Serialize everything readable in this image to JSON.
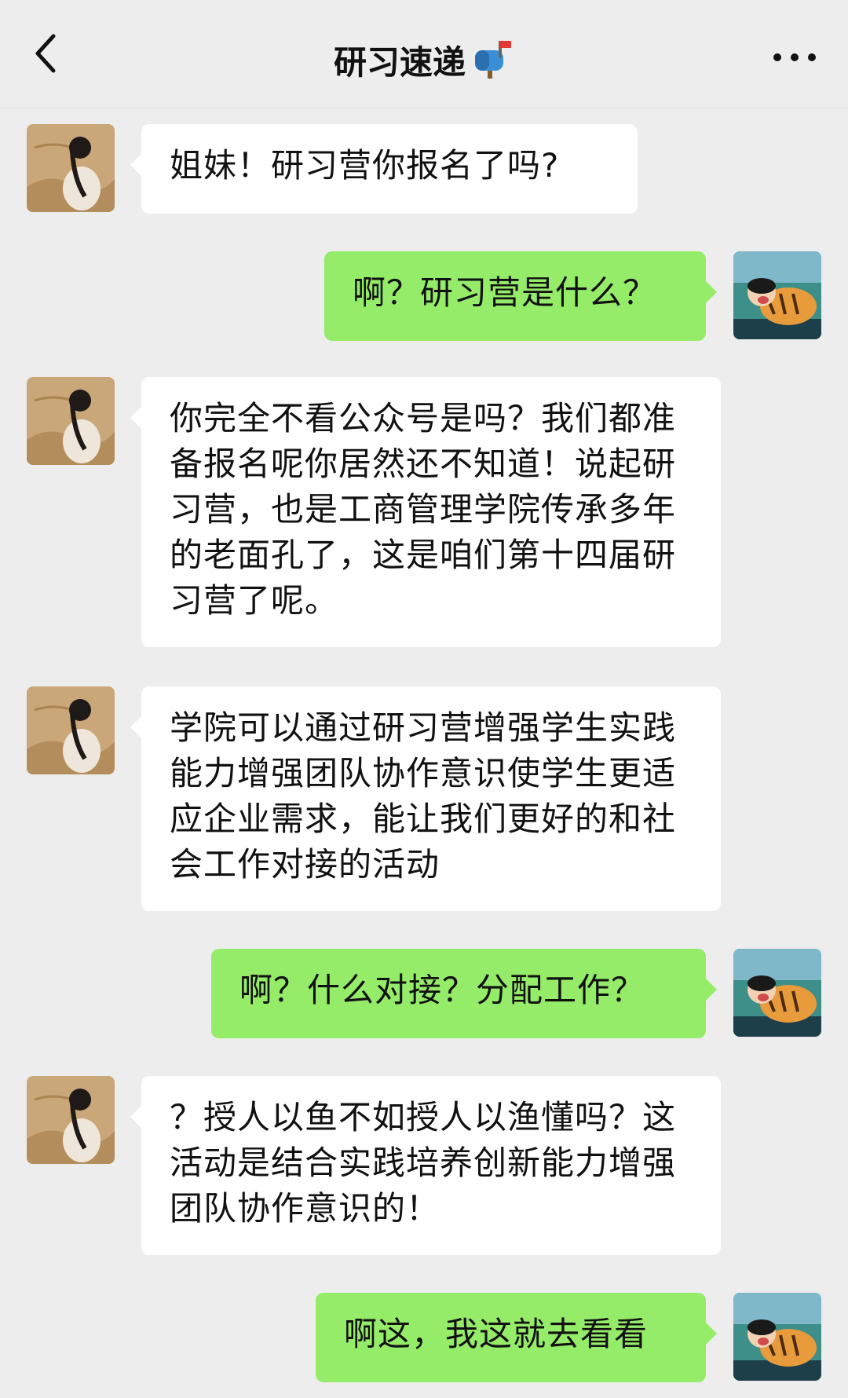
{
  "header": {
    "title": "研习速递",
    "title_icon": "mailbox-icon",
    "back_icon": "chevron-left-icon",
    "more_icon": "more-dots-icon"
  },
  "contacts": {
    "friend_avatar": "girl-in-white-avatar",
    "self_avatar": "cartoon-boy-with-tiger-avatar"
  },
  "messages": [
    {
      "from": "friend",
      "text": "姐妹！研习营你报名了吗?"
    },
    {
      "from": "self",
      "text": "啊？研习营是什么？"
    },
    {
      "from": "friend",
      "text": "你完全不看公众号是吗？我们都准备报名呢你居然还不知道！说起研习营，也是工商管理学院传承多年的老面孔了，这是咱们第十四届研习营了呢。"
    },
    {
      "from": "friend",
      "text": "学院可以通过研习营增强学生实践能力增强团队协作意识使学生更适应企业需求，能让我们更好的和社会工作对接的活动"
    },
    {
      "from": "self",
      "text": "啊？什么对接？分配工作？"
    },
    {
      "from": "friend",
      "text": "？授人以鱼不如授人以渔懂吗？这活动是结合实践培养创新能力增强团队协作意识的！"
    },
    {
      "from": "self",
      "text": "啊这，我这就去看看"
    }
  ],
  "colors": {
    "background": "#ededed",
    "friend_bubble": "#ffffff",
    "self_bubble": "#95ec69"
  }
}
